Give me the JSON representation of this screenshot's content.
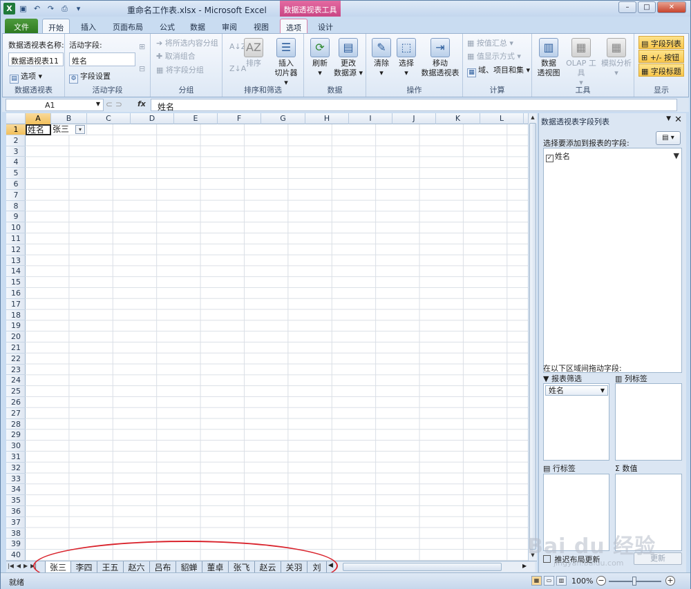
{
  "title": {
    "doc": "重命名工作表.xlsx - Microsoft Excel",
    "context_group": "数据透视表工具"
  },
  "tabs": [
    "文件",
    "开始",
    "插入",
    "页面布局",
    "公式",
    "数据",
    "审阅",
    "视图",
    "选项",
    "设计"
  ],
  "ribbon": {
    "pivot_name_label": "数据透视表名称:",
    "pivot_name_value": "数据透视表11",
    "options_btn": "选项",
    "group_pivot": "数据透视表",
    "active_field_label": "活动字段:",
    "active_field_value": "姓名",
    "field_settings": "字段设置",
    "group_active_field": "活动字段",
    "grp_selection": "将所选内容分组",
    "ungroup": "取消组合",
    "grp_field": "将字段分组",
    "group_group": "分组",
    "sort": "排序",
    "insert_slicer_1": "插入",
    "insert_slicer_2": "切片器",
    "group_sort": "排序和筛选",
    "refresh": "刷新",
    "change_src_1": "更改",
    "change_src_2": "数据源",
    "group_data": "数据",
    "clear": "清除",
    "select": "选择",
    "move_1": "移动",
    "move_2": "数据透视表",
    "group_actions": "操作",
    "summarize": "按值汇总",
    "show_values": "值显示方式",
    "fields_items": "域、项目和集",
    "group_calc": "计算",
    "pivotchart_1": "数据",
    "pivotchart_2": "透视图",
    "olap": "OLAP 工具",
    "whatif": "模拟分析",
    "group_tools": "工具",
    "field_list": "字段列表",
    "plus_minus": "+/- 按钮",
    "field_headers": "字段标题",
    "group_show": "显示"
  },
  "formula": {
    "cell": "A1",
    "fx": "fx",
    "value": "姓名"
  },
  "columns": [
    "A",
    "B",
    "C",
    "D",
    "E",
    "F",
    "G",
    "H",
    "I",
    "J",
    "K",
    "L"
  ],
  "rows": [
    "1",
    "2",
    "3",
    "4",
    "5",
    "6",
    "7",
    "8",
    "9",
    "10",
    "11",
    "12",
    "13",
    "14",
    "15",
    "16",
    "17",
    "18",
    "19",
    "20",
    "21",
    "22",
    "23",
    "24",
    "25",
    "26",
    "27",
    "28",
    "29",
    "30",
    "31",
    "32",
    "33",
    "34",
    "35",
    "36",
    "37",
    "38",
    "39",
    "40"
  ],
  "cells": {
    "A1": "姓名",
    "B1": "张三"
  },
  "sheets": [
    "张三",
    "李四",
    "王五",
    "赵六",
    "吕布",
    "貂蝉",
    "董卓",
    "张飞",
    "赵云",
    "关羽",
    "刘"
  ],
  "pane": {
    "title": "数据透视表字段列表",
    "choose_fields": "选择要添加到报表的字段:",
    "field": "姓名",
    "drag_label": "在以下区域间拖动字段:",
    "report_filter": "报表筛选",
    "column_labels": "列标签",
    "row_labels": "行标签",
    "values": "数值",
    "filter_chip": "姓名",
    "defer": "推迟布局更新",
    "update": "更新"
  },
  "status": {
    "ready": "就绪",
    "zoom": "100%"
  },
  "watermark": {
    "brand": "Bai du 经验",
    "url": "jingyan.baidu.com"
  }
}
